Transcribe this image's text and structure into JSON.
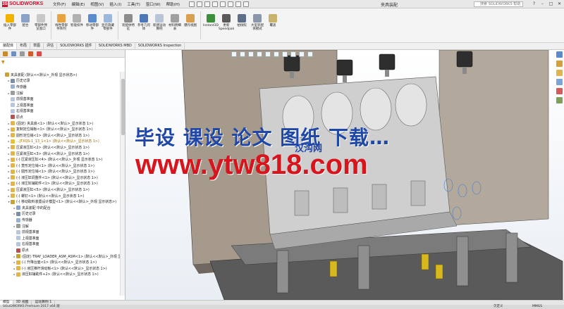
{
  "app": {
    "brand": "SOLIDWORKS",
    "document_title": "夹具装配",
    "search_placeholder": "搜索 SOLIDWORKS 帮助"
  },
  "menu": [
    "文件(F)",
    "编辑(E)",
    "视图(V)",
    "插入(I)",
    "工具(T)",
    "窗口(W)",
    "帮助(H)"
  ],
  "ribbon": [
    {
      "label": "插入零部件",
      "icon": "insert-component-icon",
      "color": "#f0b400"
    },
    {
      "label": "配合",
      "icon": "mate-icon",
      "color": "#8aa2c8"
    },
    {
      "label": "零部件预览窗口",
      "icon": "preview-window-icon",
      "color": "#c8c8c8"
    },
    {
      "label": "线性零部件阵列",
      "icon": "pattern-icon",
      "color": "#e7a33f"
    },
    {
      "label": "智能扣件",
      "icon": "smart-fasteners-icon",
      "color": "#b1b1b1"
    },
    {
      "label": "移动零部件",
      "icon": "move-component-icon",
      "color": "#5a8ccb"
    },
    {
      "label": "显示隐藏零部件",
      "icon": "show-hide-icon",
      "color": "#9cb7dd"
    },
    {
      "label": "装配体特征",
      "icon": "assembly-feature-icon",
      "color": "#8c8c8c"
    },
    {
      "label": "参考几何体",
      "icon": "reference-geometry-icon",
      "color": "#4c79b5"
    },
    {
      "label": "新建运动算例",
      "icon": "motion-study-icon",
      "color": "#b9c4d6"
    },
    {
      "label": "材料明细表",
      "icon": "bom-icon",
      "color": "#a0a0a0"
    },
    {
      "label": "爆炸视图",
      "icon": "exploded-view-icon",
      "color": "#d8a050"
    },
    {
      "label": "Instant3D",
      "icon": "instant3d-icon",
      "color": "#3c8f3c"
    },
    {
      "label": "更新Speedpak",
      "icon": "speedpak-icon",
      "color": "#5a5a5a"
    },
    {
      "label": "拍快照",
      "icon": "snapshot-icon",
      "color": "#5d6f88"
    },
    {
      "label": "大型装配体模式",
      "icon": "large-assembly-icon",
      "color": "#8a97aa"
    },
    {
      "label": "覆盖",
      "icon": "cover-icon",
      "color": "#c9b26b"
    }
  ],
  "command_tabs": [
    "装配体",
    "布局",
    "草图",
    "评估",
    "SOLIDWORKS 插件",
    "SOLIDWORKS MBD",
    "SOLIDWORKS Inspection"
  ],
  "panel_tabs": [
    {
      "icon": "feature-manager-icon",
      "color": "#c98b2c"
    },
    {
      "icon": "property-manager-icon",
      "color": "#6e8fc2"
    },
    {
      "icon": "configuration-manager-icon",
      "color": "#9a9a9a"
    },
    {
      "icon": "dimxpert-icon",
      "color": "#d05a2a"
    },
    {
      "icon": "display-manager-icon",
      "color": "#d94a4a"
    }
  ],
  "tree": [
    {
      "level": 0,
      "text": "夹具装配 (默认<<默认>_外观 显示状态>)",
      "icon": "#c9a233",
      "tri": "",
      "warn": false
    },
    {
      "level": 1,
      "text": "历史记录",
      "icon": "#7b8ea6",
      "tri": "▸",
      "warn": false
    },
    {
      "level": 1,
      "text": "传感器",
      "icon": "#9ab1cc",
      "tri": "",
      "warn": false
    },
    {
      "level": 1,
      "text": "注解",
      "icon": "#9b9b9b",
      "tri": "▸",
      "warn": false
    },
    {
      "level": 1,
      "text": "前视基准面",
      "icon": "#b7c6dc",
      "tri": "",
      "warn": false
    },
    {
      "level": 1,
      "text": "上视基准面",
      "icon": "#b7c6dc",
      "tri": "",
      "warn": false
    },
    {
      "level": 1,
      "text": "右视基准面",
      "icon": "#b7c6dc",
      "tri": "",
      "warn": false
    },
    {
      "level": 1,
      "text": "原点",
      "icon": "#b45151",
      "tri": "",
      "warn": false
    },
    {
      "level": 1,
      "text": "(固定) 夹具底<1> (默认<<默认>_显示状态 1>)",
      "icon": "#e2b54a",
      "tri": "▸",
      "warn": false
    },
    {
      "level": 1,
      "text": "复制定位销板<1> (默认<<默认>_显示状态 1>)",
      "icon": "#e2b54a",
      "tri": "▸",
      "warn": false
    },
    {
      "level": 1,
      "text": "圆形定位销<1> (默认<<默认>_显示状态 1>)",
      "icon": "#e2b54a",
      "tri": "▸",
      "warn": false
    },
    {
      "level": 1,
      "text": "...JTXQS-1_13_1<1> (默认<<默认>_显示状态 1>)",
      "icon": "#e5c235",
      "tri": "▸",
      "warn": true
    },
    {
      "level": 1,
      "text": "压紧液压缸<2> (默认<<默认>_显示状态 1>)",
      "icon": "#e2b54a",
      "tri": "▸",
      "warn": false
    },
    {
      "level": 1,
      "text": "压紧液压缸<3> (默认<<默认>_显示状态 1>)",
      "icon": "#e2b54a",
      "tri": "▸",
      "warn": false
    },
    {
      "level": 1,
      "text": "(-) 压紧液压缸<4> (默认<<默认>_外观 显示状态 1>)",
      "icon": "#e2b54a",
      "tri": "▸",
      "warn": false
    },
    {
      "level": 1,
      "text": "(-) 菱形定位销<1> (默认<<默认>_显示状态 1>)",
      "icon": "#e2b54a",
      "tri": "▸",
      "warn": false
    },
    {
      "level": 1,
      "text": "(-) 圆形定位销<1> (默认<<默认>_显示状态 1>)",
      "icon": "#e2b54a",
      "tri": "▸",
      "warn": false
    },
    {
      "level": 1,
      "text": "(-) 液压缸调整件<1> (默认<<默认>_显示状态 1>)",
      "icon": "#e2b54a",
      "tri": "▸",
      "warn": false
    },
    {
      "level": 1,
      "text": "(-) 液压缸辅助件<1> (默认<<默认>_显示状态 1>)",
      "icon": "#e2b54a",
      "tri": "▸",
      "warn": false
    },
    {
      "level": 1,
      "text": "压紧液压缸<5> (默认<<默认>_显示状态 1>)",
      "icon": "#e2b54a",
      "tri": "▸",
      "warn": false
    },
    {
      "level": 1,
      "text": "(-) 螺钉<1> (默认<<默认>_显示状态 1>)",
      "icon": "#e2b54a",
      "tri": "▸",
      "warn": false
    },
    {
      "level": 1,
      "text": "(-) 移动取料装置设计模型<1> (默认<<默认>_外观 显示状态>)",
      "icon": "#c9a233",
      "tri": "▾",
      "warn": false
    },
    {
      "level": 2,
      "text": "夹具装配 中的配合",
      "icon": "#8aa2c8",
      "tri": "▸",
      "warn": false
    },
    {
      "level": 2,
      "text": "历史记录",
      "icon": "#7b8ea6",
      "tri": "▸",
      "warn": false
    },
    {
      "level": 2,
      "text": "传感器",
      "icon": "#9ab1cc",
      "tri": "",
      "warn": false
    },
    {
      "level": 2,
      "text": "注解",
      "icon": "#9b9b9b",
      "tri": "▸",
      "warn": false
    },
    {
      "level": 2,
      "text": "前视基准面",
      "icon": "#b7c6dc",
      "tri": "",
      "warn": false
    },
    {
      "level": 2,
      "text": "上视基准面",
      "icon": "#b7c6dc",
      "tri": "",
      "warn": false
    },
    {
      "level": 2,
      "text": "右视基准面",
      "icon": "#b7c6dc",
      "tri": "",
      "warn": false
    },
    {
      "level": 2,
      "text": "原点",
      "icon": "#b45151",
      "tri": "",
      "warn": false
    },
    {
      "level": 2,
      "text": "(固定) TRAY_LOADER_ASM_ASM<1> (默认<<默认>_外观 显",
      "icon": "#c9a233",
      "tri": "▸",
      "warn": false
    },
    {
      "level": 2,
      "text": "(-) 升降台面<1> (默认<<默认>_显示状态 1>)",
      "icon": "#e2b54a",
      "tri": "▸",
      "warn": false
    },
    {
      "level": 2,
      "text": "(-) 液压推杆滑动板<1> (默认<<默认>_显示状态 1>)",
      "icon": "#e2b54a",
      "tri": "▸",
      "warn": false
    },
    {
      "level": 2,
      "text": "液压缸辅助件+2> (默认<<默认>_显示状态 1>)",
      "icon": "#e2b54a",
      "tri": "▸",
      "warn": false
    }
  ],
  "viewport_toolbar_icons": [
    "zoom-fit-icon",
    "zoom-area-icon",
    "previous-view-icon",
    "section-view-icon",
    "view-orientation-icon",
    "display-style-icon",
    "hide-show-icon",
    "edit-appearance-icon",
    "scene-icon",
    "view-settings-icon"
  ],
  "viewport_side_icons": [
    {
      "icon": "home-view-icon",
      "color": "#5b8bc9"
    },
    {
      "icon": "design-library-icon",
      "color": "#d3a03a"
    },
    {
      "icon": "file-explorer-icon",
      "color": "#e0b54e"
    },
    {
      "icon": "view-palette-icon",
      "color": "#7aa5d6"
    },
    {
      "icon": "appearances-icon",
      "color": "#d45b5b"
    },
    {
      "icon": "custom-properties-icon",
      "color": "#7f9f5a"
    }
  ],
  "overlay": {
    "headline": "毕设 课设 论文 图纸 下载…",
    "url": "www.ytw818.com",
    "badge": "汉沟网",
    "small": "ytw818.com"
  },
  "bottom_tabs": [
    "模型",
    "3D 视图",
    "运动算例 1"
  ],
  "status": {
    "left": "SOLIDWORKS Premium 2017 x64 版",
    "center_left": "欠定义",
    "center_right": "在编辑 装配体",
    "units": "MMGS"
  }
}
